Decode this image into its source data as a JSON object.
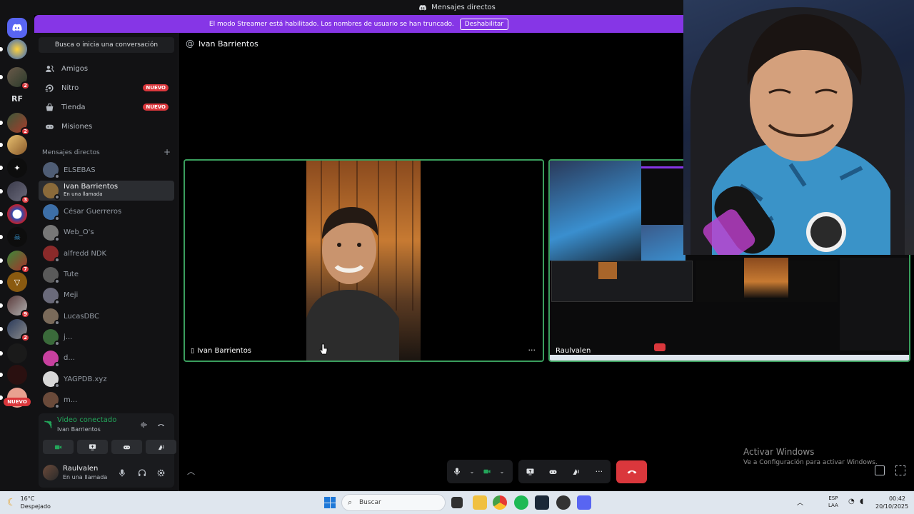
{
  "window": {
    "title": "Mensajes directos"
  },
  "banner": {
    "text": "El modo Streamer está habilitado. Los nombres de usuario se han truncado.",
    "button": "Deshabilitar"
  },
  "rail": {
    "rf_label": "RF",
    "new_badge": "NUEVO",
    "badges": [
      "2",
      "2",
      "3",
      "7",
      "9",
      "2"
    ]
  },
  "sidebar": {
    "search": "Busca o inicia una conversación",
    "nav": [
      {
        "label": "Amigos",
        "icon": "friends-icon",
        "badge": ""
      },
      {
        "label": "Nitro",
        "icon": "nitro-icon",
        "badge": "NUEVO"
      },
      {
        "label": "Tienda",
        "icon": "shop-icon",
        "badge": "NUEVO"
      },
      {
        "label": "Misiones",
        "icon": "quests-icon",
        "badge": ""
      }
    ],
    "dm_header": "Mensajes directos",
    "dm_add": "+",
    "dms": [
      {
        "name": "ELSEBAS",
        "sub": "",
        "color": "#4f5d75"
      },
      {
        "name": "Ivan Barrientos",
        "sub": "En una llamada",
        "color": "#8a6a3a"
      },
      {
        "name": "César Guerreros",
        "sub": "",
        "color": "#3d6fa8"
      },
      {
        "name": "Web_O's",
        "sub": "",
        "color": "#777777"
      },
      {
        "name": "alfredd NDK",
        "sub": "",
        "color": "#8a2a2a"
      },
      {
        "name": "Tute",
        "sub": "",
        "color": "#5a5a5a"
      },
      {
        "name": "Meji",
        "sub": "",
        "color": "#6a6a7a"
      },
      {
        "name": "LucasDBC",
        "sub": "",
        "color": "#7a6a5a"
      },
      {
        "name": "j...",
        "sub": "",
        "color": "#3a6a3a"
      },
      {
        "name": "d...",
        "sub": "",
        "color": "#c8409f"
      },
      {
        "name": "YAGPDB.xyz",
        "sub": "",
        "color": "#d8d8d8"
      },
      {
        "name": "m...",
        "sub": "",
        "color": "#6a4a3a"
      }
    ]
  },
  "voice": {
    "status": "Video conectado",
    "channel": "Ivan Barrientos"
  },
  "user": {
    "name": "Raulvalen",
    "status": "En una llamada"
  },
  "call": {
    "title": "Ivan Barrientos",
    "tiles": [
      {
        "name": "Ivan Barrientos"
      },
      {
        "name": "Raulvalen"
      }
    ],
    "more": "···"
  },
  "watermark": {
    "line1": "Activar Windows",
    "line2": "Ve a Configuración para activar Windows."
  },
  "taskbar": {
    "temp": "16°C",
    "weather": "Despejado",
    "search": "Buscar",
    "lang1": "ESP",
    "lang2": "LAA",
    "time": "00:42",
    "date": "20/10/2025"
  },
  "colors": {
    "accent": "#5865f2",
    "streamer": "#8636e6",
    "online": "#23a55a",
    "danger": "#da373c",
    "tile_border": "#3a9e5d"
  }
}
